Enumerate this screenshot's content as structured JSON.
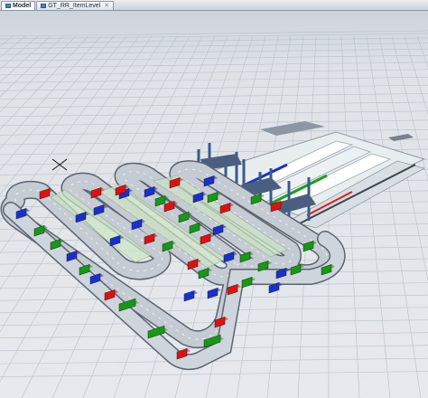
{
  "tabs": [
    {
      "label": "Model",
      "active": true
    },
    {
      "label": "GT_RR_ItemLevel",
      "active": false
    }
  ],
  "scene": {
    "background_color": "#d8dde3",
    "grid_color": "#b9c1cb",
    "item_colors": {
      "red": "#e11010",
      "green": "#149a14",
      "blue": "#1a2fd0"
    },
    "conveyor_color": "#c4cbd3",
    "rack_color": "#3a5a8c"
  }
}
